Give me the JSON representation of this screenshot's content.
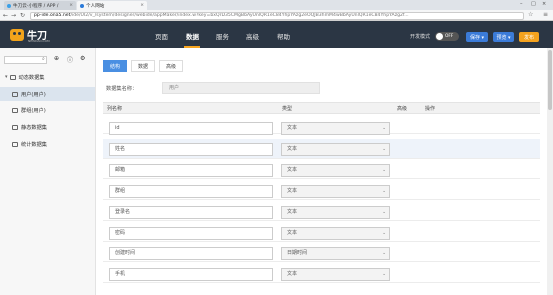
{
  "browser": {
    "tabs": [
      {
        "label": "牛刀云-小程序 / APP /"
      },
      {
        "label": "个人网站"
      }
    ],
    "url_host": "pp-ide.ona5.net",
    "url_path": "/ide/UI2/v_/system/designer/webide/appMaker/index.w?key=bxQrD35CMgBbAyUnlQR1eC84YhpYAzg2eOQJB3hmM4wBbAyUnlQR1eC84YhpYAzg2f..."
  },
  "app": {
    "logo_text": "牛刀",
    "logo_sub": "NEWDAO.COM",
    "nav": [
      "页面",
      "数据",
      "服务",
      "高级",
      "帮助"
    ],
    "dev_mode_label": "开发模式",
    "toggle_label": "OFF",
    "save_label": "保存 ▾",
    "preview_label": "预览 ▾",
    "publish_label": "发布"
  },
  "sidebar": {
    "items": [
      {
        "label": "动态数据集"
      },
      {
        "label": "用户(用户)"
      },
      {
        "label": "群组(用户)"
      },
      {
        "label": "静态数据集"
      },
      {
        "label": "统计数据集"
      }
    ]
  },
  "main": {
    "tabs": [
      "结构",
      "数据",
      "高级"
    ],
    "dataset_name_label": "数据集名称：",
    "dataset_name_value": "用户",
    "columns": [
      "列名称",
      "类型",
      "高级",
      "操作"
    ],
    "rows": [
      {
        "name": "id",
        "type": "文本"
      },
      {
        "name": "姓名",
        "type": "文本"
      },
      {
        "name": "邮箱",
        "type": "文本"
      },
      {
        "name": "群组",
        "type": "文本"
      },
      {
        "name": "登录名",
        "type": "文本"
      },
      {
        "name": "密码",
        "type": "文本"
      },
      {
        "name": "创建时间",
        "type": "日期时间"
      },
      {
        "name": "手机",
        "type": "文本"
      }
    ]
  }
}
